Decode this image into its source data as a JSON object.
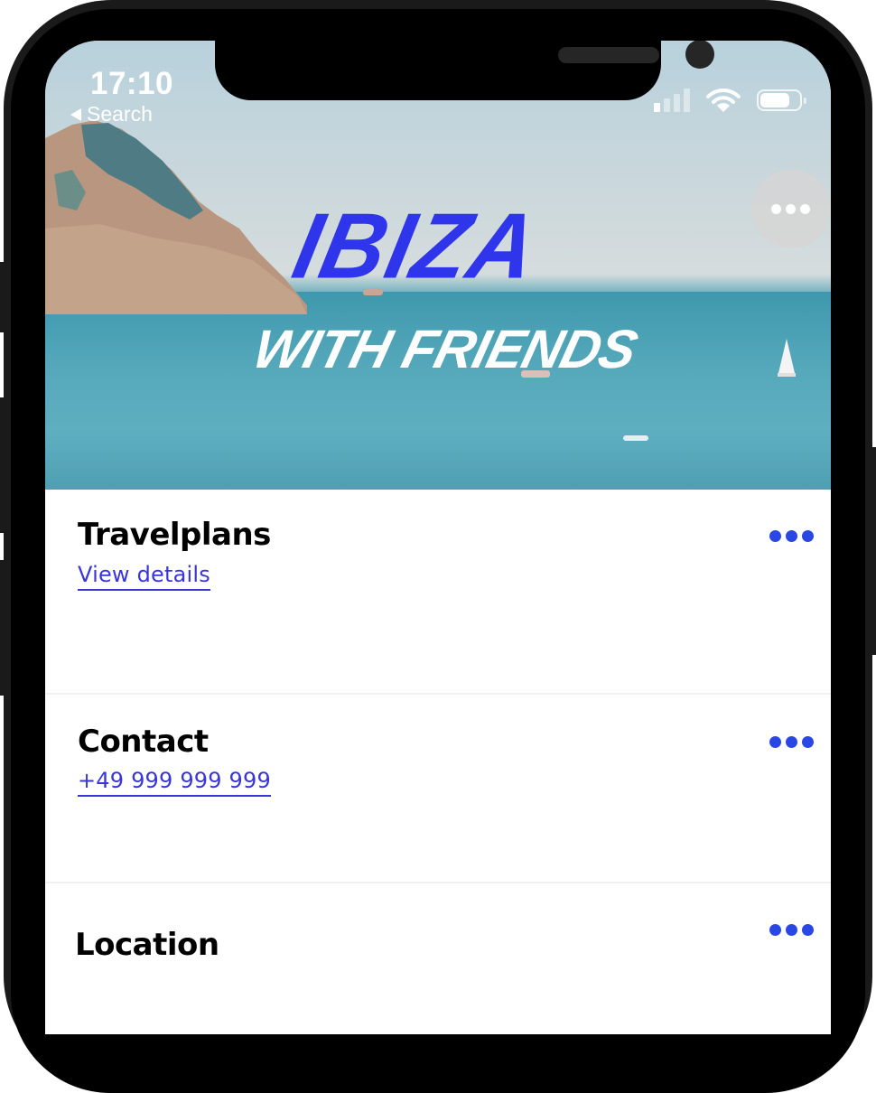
{
  "status_bar": {
    "time": "17:10",
    "back_label": "Search",
    "signal_bars_active": 1,
    "signal_bars_total": 4,
    "battery_level": 0.75
  },
  "hero": {
    "title": "IBIZA",
    "subtitle": "WITH FRIENDS",
    "title_color": "#2f35ea",
    "subtitle_color": "#ffffff",
    "more_button_icon": "more-horizontal-icon"
  },
  "sections": [
    {
      "title": "Travelplans",
      "link": "View details",
      "menu_icon": "more-horizontal-icon"
    },
    {
      "title": "Contact",
      "link": "+49 999 999 999",
      "menu_icon": "more-horizontal-icon"
    },
    {
      "title": "Location",
      "menu_icon": "more-horizontal-icon"
    }
  ],
  "colors": {
    "accent": "#2a46e3",
    "link": "#3a35d8",
    "frame": "#000000"
  }
}
